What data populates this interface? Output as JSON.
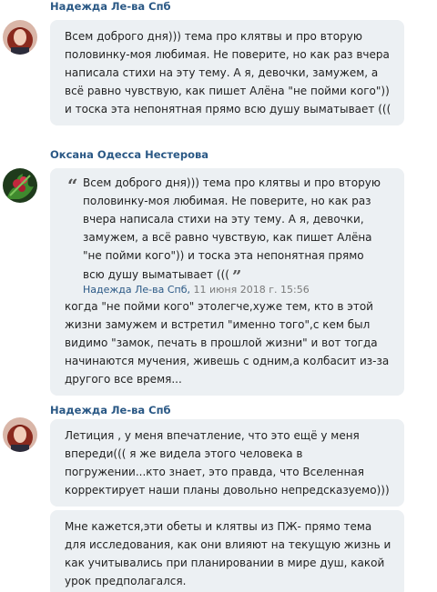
{
  "messages": [
    {
      "author": "Надежда Ле-ва Спб",
      "text": "Всем доброго дня))) тема про клятвы и про вторую половинку-моя любимая. Не поверите, но как раз вчера написала стихи на эту тему. А я, девочки, замужем, а всё равно чувствую, как пишет Алёна \"не пойми кого\")) и тоска эта непонятная прямо всю душу выматывает (((",
      "avatar": "avatar-woman-red-hair"
    },
    {
      "author": "Оксана Одесса Нестерова",
      "quote": {
        "text": "Всем доброго дня))) тема про клятвы и про вторую половинку-моя любимая. Не поверите, но как раз вчера написала стихи на эту тему. А я, девочки, замужем, а всё равно чувствую, как пишет Алёна \"не пойми кого\")) и тоска эта непонятная прямо всю душу выматывает (((",
        "author": "Надежда Ле-ва Спб",
        "timestamp": "11 июня 2018 г. 15:56"
      },
      "text": "когда \"не пойми кого\" этолегче,хуже тем, кто в этой жизни замужем и встретил \"именно того\",с кем был видимо \"замок, печать в прошлой жизни\" и вот тогда начинаются мучения, живешь с одним,а колбасит из-за другого все время...",
      "avatar": "avatar-flower-green"
    },
    {
      "author": "Надежда Ле-ва Спб",
      "text": "Летиция , у меня впечатление, что это ещё у меня впереди((( я же видела этого человека в погружении...кто знает, это правда, что Вселенная корректирует наши планы довольно непредсказуемо)))",
      "avatar": "avatar-woman-red-hair"
    },
    {
      "text": "Мне кажется,эти обеты и клятвы из ПЖ- прямо тема для исследования, как они влияют на текущую жизнь и как учитывались при планировании в мире душ, какой урок предполагался."
    }
  ],
  "colors": {
    "author_link": "#2a5885",
    "bubble_bg": "#ecf0f3",
    "text": "#222222"
  }
}
